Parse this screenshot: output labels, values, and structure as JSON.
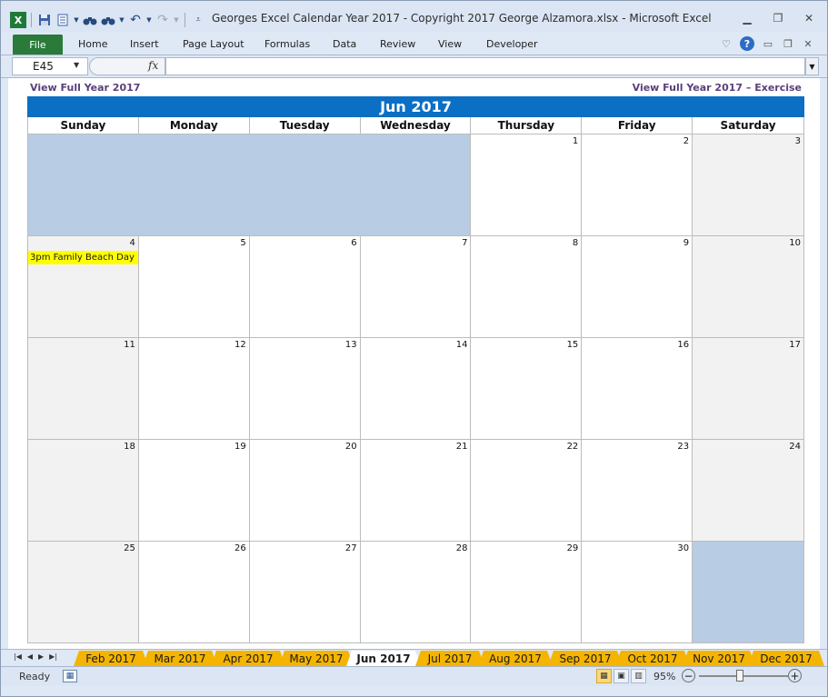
{
  "window": {
    "title": "Georges Excel Calendar Year 2017  -  Copyright 2017 George Alzamora.xlsx  -  Microsoft Excel"
  },
  "ribbon": {
    "file_label": "File",
    "tabs": [
      "Home",
      "Insert",
      "Page Layout",
      "Formulas",
      "Data",
      "Review",
      "View",
      "Developer"
    ]
  },
  "formula_bar": {
    "name_box": "E45",
    "fx_label": "fx",
    "formula_value": ""
  },
  "sheet": {
    "link_left": "View Full Year 2017",
    "link_right": "View Full Year 2017 – Exercise",
    "month_title": "Jun 2017",
    "weekdays": [
      "Sunday",
      "Monday",
      "Tuesday",
      "Wednesday",
      "Thursday",
      "Friday",
      "Saturday"
    ],
    "weeks": [
      [
        "",
        "",
        "",
        "",
        "1",
        "2",
        "3"
      ],
      [
        "4",
        "5",
        "6",
        "7",
        "8",
        "9",
        "10"
      ],
      [
        "11",
        "12",
        "13",
        "14",
        "15",
        "16",
        "17"
      ],
      [
        "18",
        "19",
        "20",
        "21",
        "22",
        "23",
        "24"
      ],
      [
        "25",
        "26",
        "27",
        "28",
        "29",
        "30",
        ""
      ]
    ],
    "events": [
      {
        "day": "4",
        "text": "3pm Family Beach Day"
      }
    ],
    "colors": {
      "header_blue": "#0b6fc4",
      "blank_cell": "#b8cce4",
      "weekend": "#f2f2f2",
      "event_highlight": "#ffff00",
      "link_purple": "#5a3f7c",
      "sheet_tab": "#f4b400"
    }
  },
  "sheet_tabs": {
    "tabs": [
      "Feb 2017",
      "Mar 2017",
      "Apr 2017",
      "May 2017",
      "Jun 2017",
      "Jul 2017",
      "Aug 2017",
      "Sep 2017",
      "Oct 2017",
      "Nov 2017",
      "Dec 2017"
    ],
    "active": "Jun 2017"
  },
  "status_bar": {
    "status": "Ready",
    "zoom": "95%",
    "zoom_fraction": 0.45
  },
  "icons": {
    "excel_logo": "X",
    "save": "save-icon",
    "find": "binoculars-icon",
    "undo": "undo-icon",
    "redo": "redo-icon"
  }
}
